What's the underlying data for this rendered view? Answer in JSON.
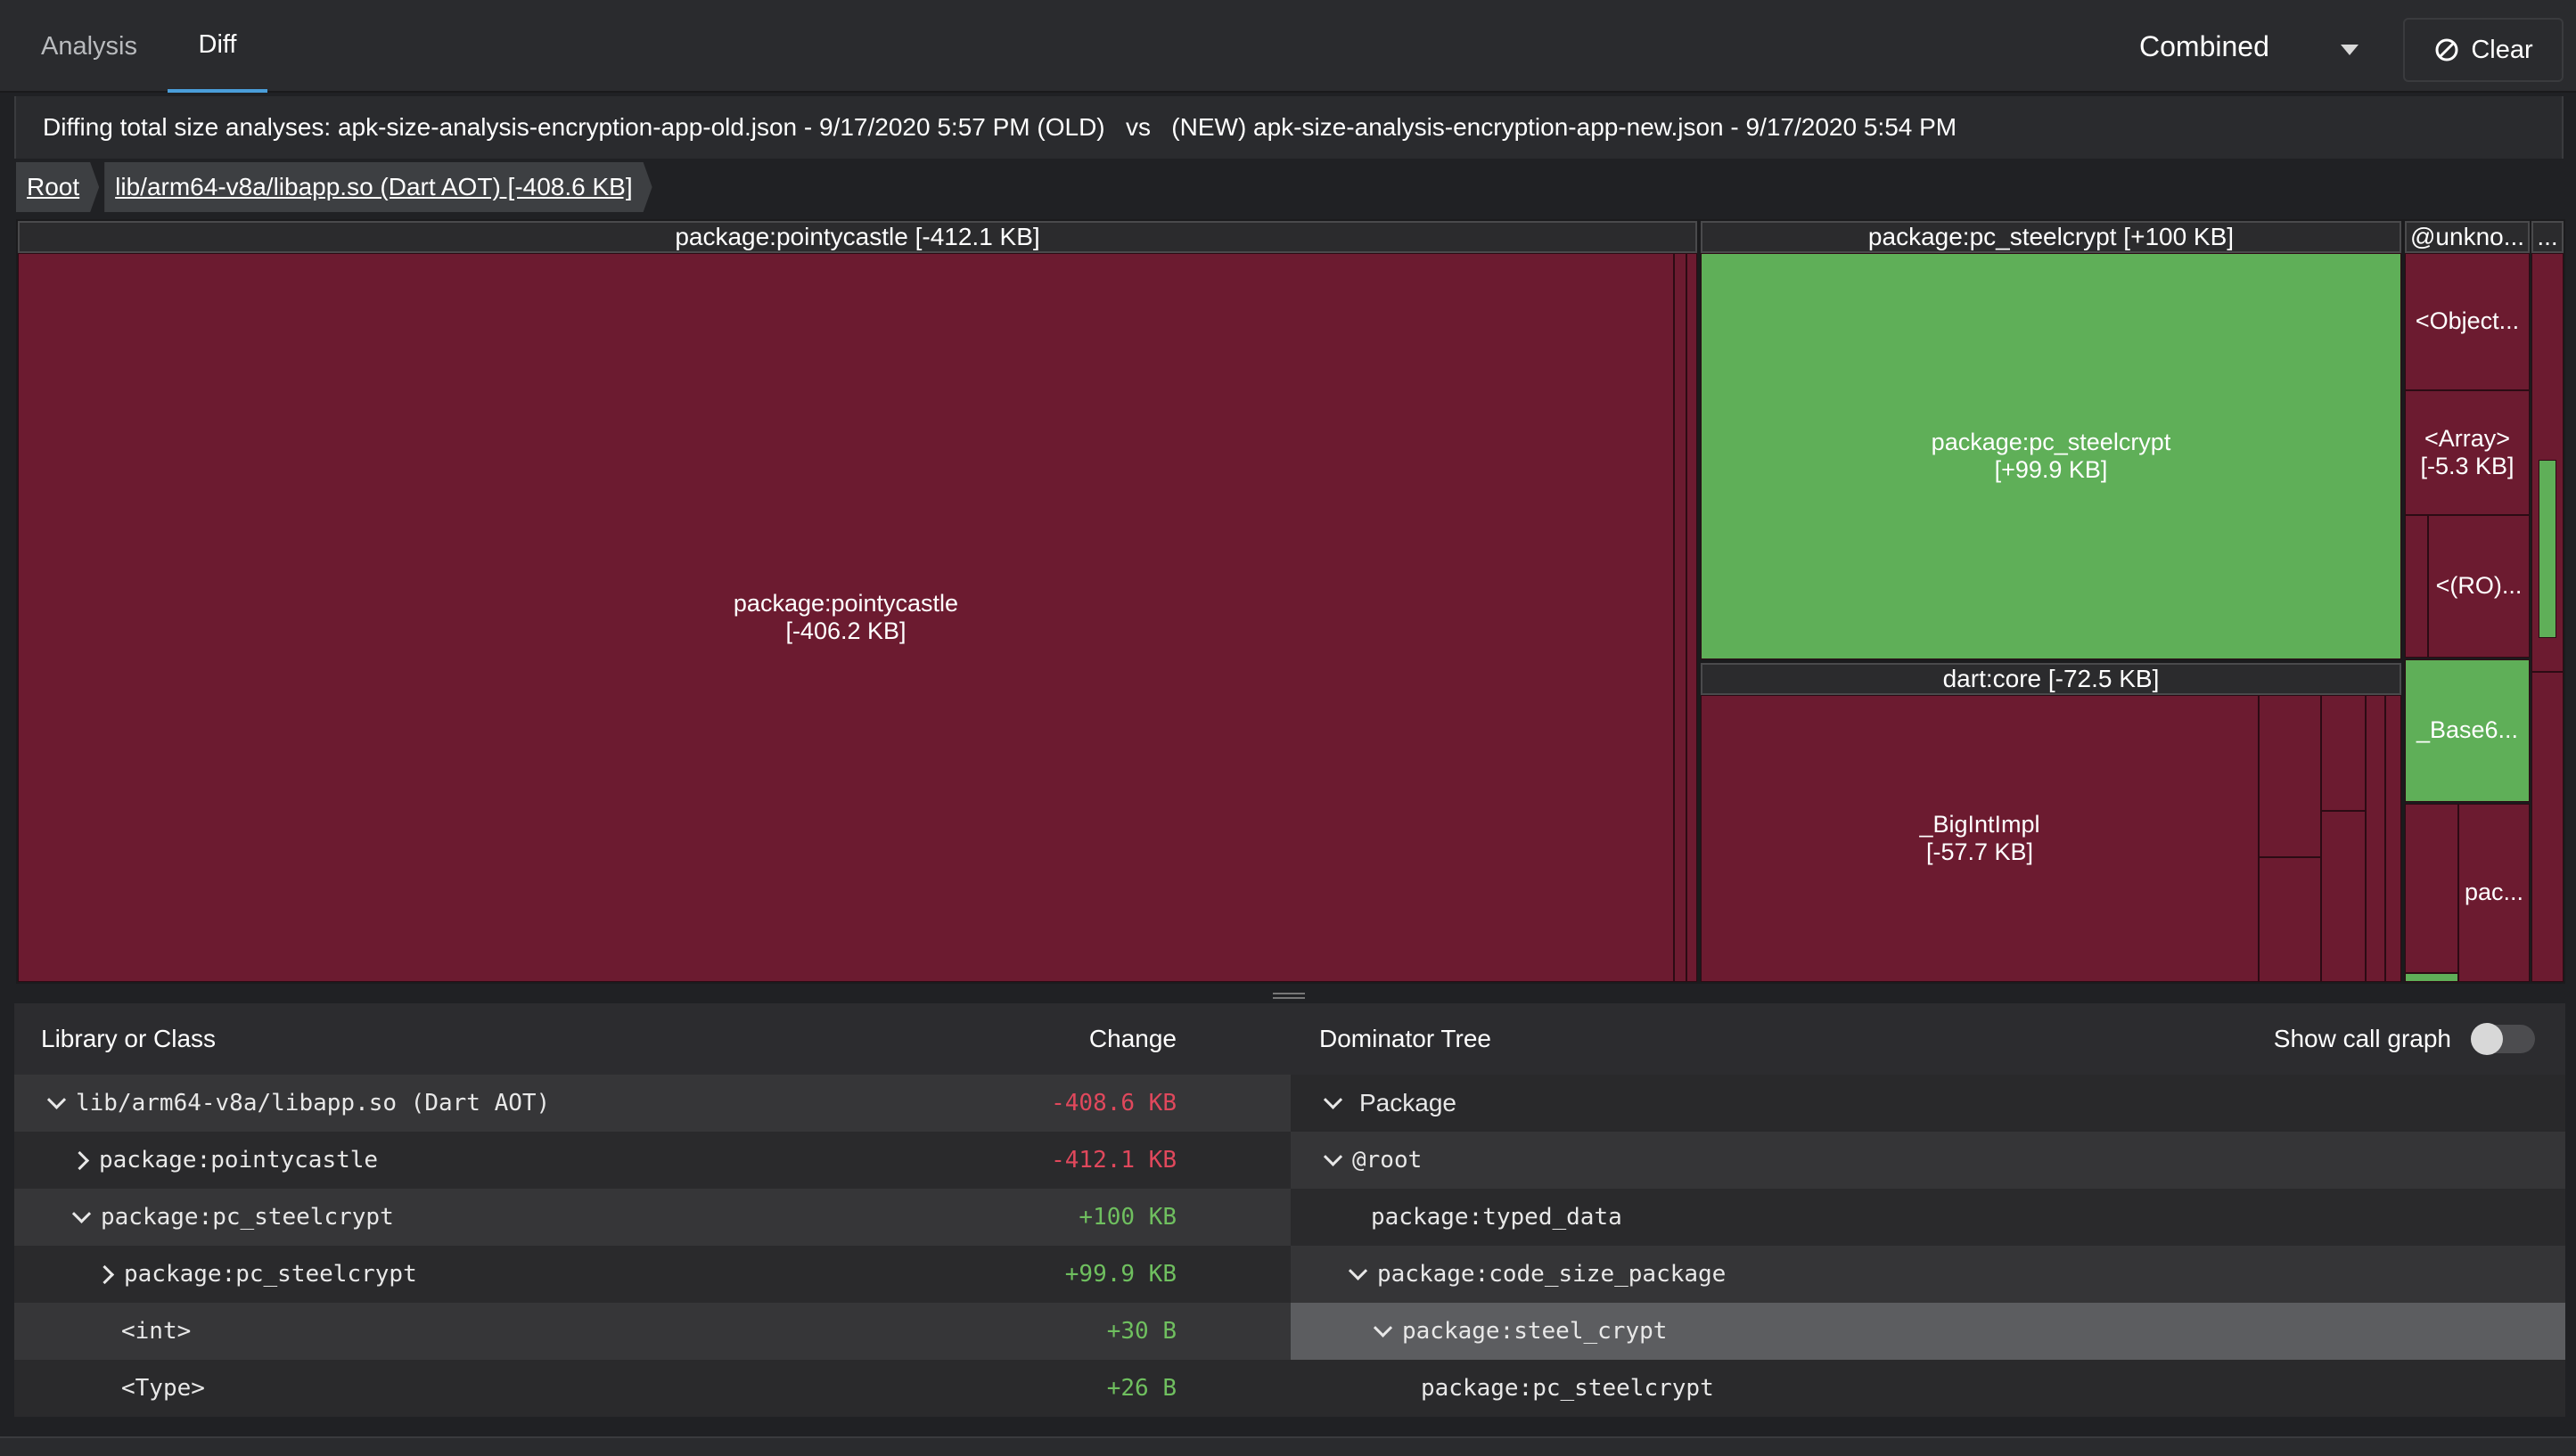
{
  "tabs": [
    {
      "label": "Analysis",
      "active": false
    },
    {
      "label": "Diff",
      "active": true
    }
  ],
  "view_select": {
    "value": "Combined"
  },
  "clear_button": {
    "label": "Clear"
  },
  "diff_title": "Diffing total size analyses: apk-size-analysis-encryption-app-old.json - 9/17/2020 5:57 PM (OLD)   vs   (NEW) apk-size-analysis-encryption-app-new.json - 9/17/2020 5:54 PM",
  "breadcrumbs": [
    "Root",
    "lib/arm64-v8a/libapp.so (Dart AOT) [-408.6 KB]"
  ],
  "treemap": {
    "colors": {
      "decrease": "#6c1b30",
      "increase": "#5faf58"
    },
    "groups": [
      {
        "header": "package:pointycastle [-412.1 KB]",
        "main_cell": "package:pointycastle\n[-406.2 KB]"
      },
      {
        "header": "package:pc_steelcrypt [+100 KB]",
        "main_cell": "package:pc_steelcrypt\n[+99.9 KB]"
      },
      {
        "header": "dart:core [-72.5 KB]",
        "main_cell": "_BigIntImpl\n[-57.7 KB]"
      },
      {
        "header": "@unkno...",
        "cells": [
          "<Object...",
          "<Array>\n[-5.3 KB]",
          "<(RO)...",
          "_Base6...",
          "pac..."
        ]
      },
      {
        "header": "...",
        "cells": [
          "...",
          "..."
        ]
      }
    ]
  },
  "left_table": {
    "headers": {
      "name": "Library or Class",
      "change": "Change"
    },
    "rows": [
      {
        "label": "lib/arm64-v8a/libapp.so (Dart AOT)",
        "change": "-408.6 KB"
      },
      {
        "label": "package:pointycastle",
        "change": "-412.1 KB"
      },
      {
        "label": "package:pc_steelcrypt",
        "change": "+100 KB"
      },
      {
        "label": "package:pc_steelcrypt",
        "change": "+99.9 KB"
      },
      {
        "label": "<int>",
        "change": "+30 B"
      },
      {
        "label": "<Type>",
        "change": "+26 B"
      }
    ]
  },
  "dominator_tree": {
    "title": "Dominator Tree",
    "show_call_graph_label": "Show call graph",
    "show_call_graph": false,
    "package_header": "Package",
    "rows": [
      "@root",
      "package:typed_data",
      "package:code_size_package",
      "package:steel_crypt",
      "package:pc_steelcrypt"
    ]
  }
}
